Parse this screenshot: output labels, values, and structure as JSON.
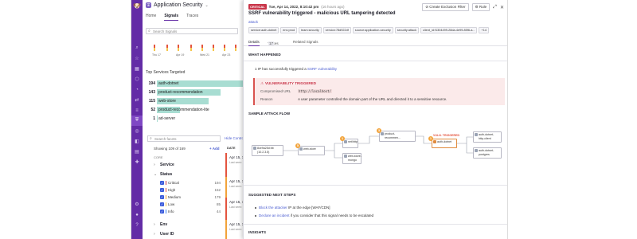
{
  "colors": {
    "nav_bg": "#632ca6",
    "accent": "#632ca6",
    "link": "#4b5dd1",
    "critical": "#c9364a",
    "service_bar": "#a8ddd2",
    "severity": {
      "critical": "#c9364a",
      "high": "#e4543f",
      "medium": "#f2a33a",
      "low": "#f5c64f",
      "info": "#3b82f6"
    }
  },
  "nav": {
    "icons": [
      "datadog-logo-icon",
      "search-icon",
      "star-icon",
      "dashboard-icon",
      "infrastructure-icon",
      "monitors-icon",
      "apm-icon",
      "logs-icon",
      "security-icon",
      "synthetics-icon",
      "rum-icon",
      "notebooks-icon",
      "integrations-icon",
      "settings-icon",
      "user-icon",
      "help-icon"
    ]
  },
  "background": {
    "app_title": "Application Security",
    "tabs": [
      "Home",
      "Signals",
      "Traces"
    ],
    "search_placeholder": "Search Signals",
    "histogram_dates": [
      "Thu 17",
      "Apr 19",
      "Wed 21",
      "Apr 23"
    ],
    "top_services_title": "Top Services Targeted",
    "services": [
      {
        "count": "194",
        "name": "auth-dotnet",
        "share": 1.0
      },
      {
        "count": "143",
        "name": "product-recommendation",
        "share": 0.74
      },
      {
        "count": "115",
        "name": "web-store",
        "share": 0.6
      },
      {
        "count": "52",
        "name": "product-recommendation-lite",
        "share": 0.27
      },
      {
        "count": "1",
        "name": "ad-server",
        "share": 0.01
      }
    ],
    "facet_search_placeholder": "Search facets",
    "hide_controls": "Hide Controls",
    "showing": "Showing 109 of 169",
    "add": "+ Add",
    "core": "CORE",
    "facets": {
      "service": "Service",
      "status": "Status",
      "status_items": [
        {
          "label": "Critical",
          "count": "194"
        },
        {
          "label": "High",
          "count": "152"
        },
        {
          "label": "Medium",
          "count": "179"
        },
        {
          "label": "Low",
          "count": "85"
        },
        {
          "label": "Info",
          "count": "44"
        }
      ],
      "env": "Env",
      "user_id": "User ID"
    },
    "results_header": "DATE",
    "results": [
      {
        "date": "Apr 15, 11:08:2",
        "seen": "Last seen: an hour ago"
      },
      {
        "date": "Apr 15, 11:06:",
        "seen": "Last seen: an hour ago"
      },
      {
        "date": "Apr 15, 11:06:",
        "seen": "Last seen: an hour ago"
      },
      {
        "date": "Apr 15, 10:56:",
        "seen": "Last seen: an hour ago"
      }
    ]
  },
  "panel": {
    "severity": "CRITICAL",
    "timestamp": "Tue, Apr 14, 2022, 8:10:42 pm",
    "ago": "(16 hours ago)",
    "create_filter": "Create Exclusion Filter",
    "rule": "Rule",
    "title": "SSRF vulnerability triggered - malicious URL tampering detected",
    "category": "attack",
    "tags": [
      "service:auth-dotnet",
      "env:prod",
      "team:security",
      "version:78d922df",
      "source:application-security",
      "security:attack",
      "client_id:f1304499-28da-4e99-85f6-a...",
      "+14"
    ],
    "tabs": {
      "details": "Details",
      "traces": "Traces",
      "traces_count": "17",
      "related": "Related Signals"
    },
    "what_happened_header": "WHAT HAPPENED",
    "what_happened_prefix": "1 IP has successfully triggered a",
    "what_happened_link": "SSRF vulnerability",
    "vuln": {
      "header": "VULNERABILITY TRIGGERED",
      "compromised_label": "Compromised URL",
      "compromised_value": "http://localhost/",
      "reason_label": "Reason",
      "reason_value": "A user parameter controlled the domain part of the URL and directed it to a sensitive resource."
    },
    "flow": {
      "title": "SAMPLE ATTACK FLOW",
      "nodes": {
        "source_ip": "8ce9a25d:bb\n(10.2.3.5)",
        "web_store": "web-store",
        "net_http": "net/http",
        "web_store_mongo": "web-store-\nmongo",
        "product_rec": "product-\nrecommen...",
        "auth_dotnet": "auth-dotnet",
        "auth_http_client": "auth-dotnet-\nhttp-client",
        "auth_postgres": "auth-dotnet-\npostgres"
      },
      "trigger_label": "VULN. TRIGGERED",
      "pins": [
        "5",
        "1",
        "3",
        "1"
      ]
    },
    "next_steps_header": "SUGGESTED NEXT STEPS",
    "steps": [
      {
        "link": "Block the attacker",
        "rest": " IP at the edge [WAF/CDN]"
      },
      {
        "link": "Declare an incident",
        "rest": " if you consider that this signal needs to be escalated"
      }
    ],
    "insights_header": "INSIGHTS"
  }
}
